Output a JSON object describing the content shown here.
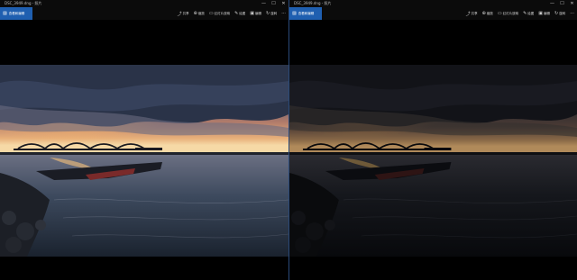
{
  "windows": [
    {
      "title": "DSC_3949.dng - 照片",
      "edit_label": "查看和编辑",
      "tools": [
        {
          "icon": "share-icon",
          "glyph": "⤴",
          "label": "共享"
        },
        {
          "icon": "zoom-icon",
          "glyph": "⊕",
          "label": "缩放"
        },
        {
          "icon": "slideshow-icon",
          "glyph": "▭",
          "label": "幻灯片放映"
        },
        {
          "icon": "draw-icon",
          "glyph": "✎",
          "label": "绘图"
        },
        {
          "icon": "edit-icon",
          "glyph": "▣",
          "label": "编辑"
        },
        {
          "icon": "rotate-icon",
          "glyph": "↻",
          "label": "旋转"
        },
        {
          "icon": "more-icon",
          "glyph": "···",
          "label": ""
        }
      ]
    },
    {
      "title": "DSC_3949.dng - 照片",
      "edit_label": "查看和编辑",
      "tools": [
        {
          "icon": "share-icon",
          "glyph": "⤴",
          "label": "共享"
        },
        {
          "icon": "zoom-icon",
          "glyph": "⊕",
          "label": "缩放"
        },
        {
          "icon": "slideshow-icon",
          "glyph": "▭",
          "label": "幻灯片放映"
        },
        {
          "icon": "draw-icon",
          "glyph": "✎",
          "label": "绘图"
        },
        {
          "icon": "edit-icon",
          "glyph": "▣",
          "label": "编辑"
        },
        {
          "icon": "rotate-icon",
          "glyph": "↻",
          "label": "旋转"
        },
        {
          "icon": "more-icon",
          "glyph": "···",
          "label": ""
        }
      ]
    }
  ],
  "window_controls": {
    "minimize": "—",
    "maximize": "☐",
    "close": "✕"
  },
  "colors": {
    "accent": "#1f5fb0",
    "chrome": "#0b0b0b"
  }
}
